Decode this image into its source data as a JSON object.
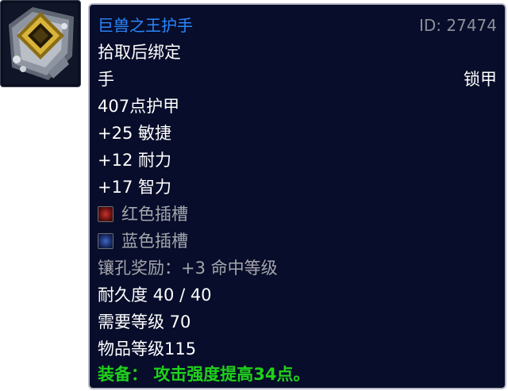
{
  "item": {
    "name": "巨兽之王护手",
    "id_label": "ID: 27474",
    "binding": "拾取后绑定",
    "slot": "手",
    "armor_type": "锁甲",
    "armor": "407点护甲",
    "stats": [
      "+25 敏捷",
      "+12 耐力",
      "+17 智力"
    ],
    "sockets": [
      {
        "label": "红色插槽",
        "color": "#c8342e"
      },
      {
        "label": "蓝色插槽",
        "color": "#3e68c8"
      }
    ],
    "socket_bonus": "镶孔奖励：+3 命中等级",
    "durability": "耐久度 40 / 40",
    "required_level": "需要等级 70",
    "item_level": "物品等级115",
    "equip_label": "装备：",
    "equip_effect": "攻击强度提高34点。"
  },
  "colors": {
    "name": "#2a86ff",
    "id": "#8c8e98",
    "grey": "#a5a6ad",
    "equip": "#1fd11a",
    "background": "#070d2a"
  },
  "icon": "gauntlet-icon"
}
